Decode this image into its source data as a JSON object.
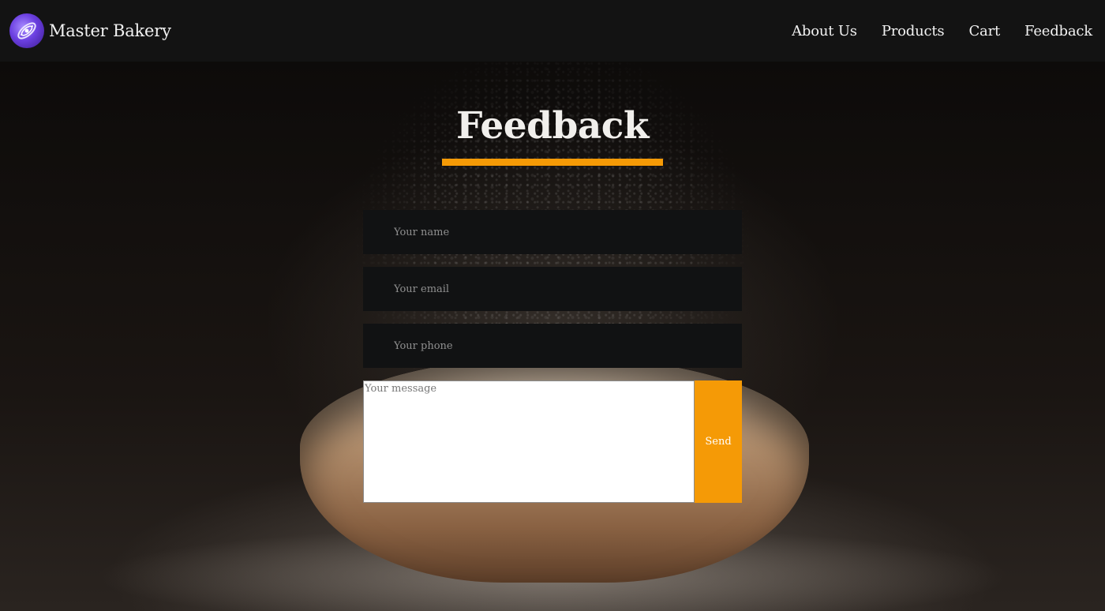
{
  "brand": {
    "name": "Master Bakery",
    "logo_icon": "galaxy-logo-icon"
  },
  "nav": {
    "items": [
      {
        "label": "About Us"
      },
      {
        "label": "Products"
      },
      {
        "label": "Cart"
      },
      {
        "label": "Feedback"
      }
    ]
  },
  "feedback": {
    "title": "Feedback",
    "name_placeholder": "Your name",
    "email_placeholder": "Your email",
    "phone_placeholder": "Your phone",
    "message_placeholder": "Your message",
    "send_label": "Send"
  },
  "colors": {
    "accent": "#f59a06",
    "header_bg": "#131313",
    "input_bg": "#111213"
  }
}
